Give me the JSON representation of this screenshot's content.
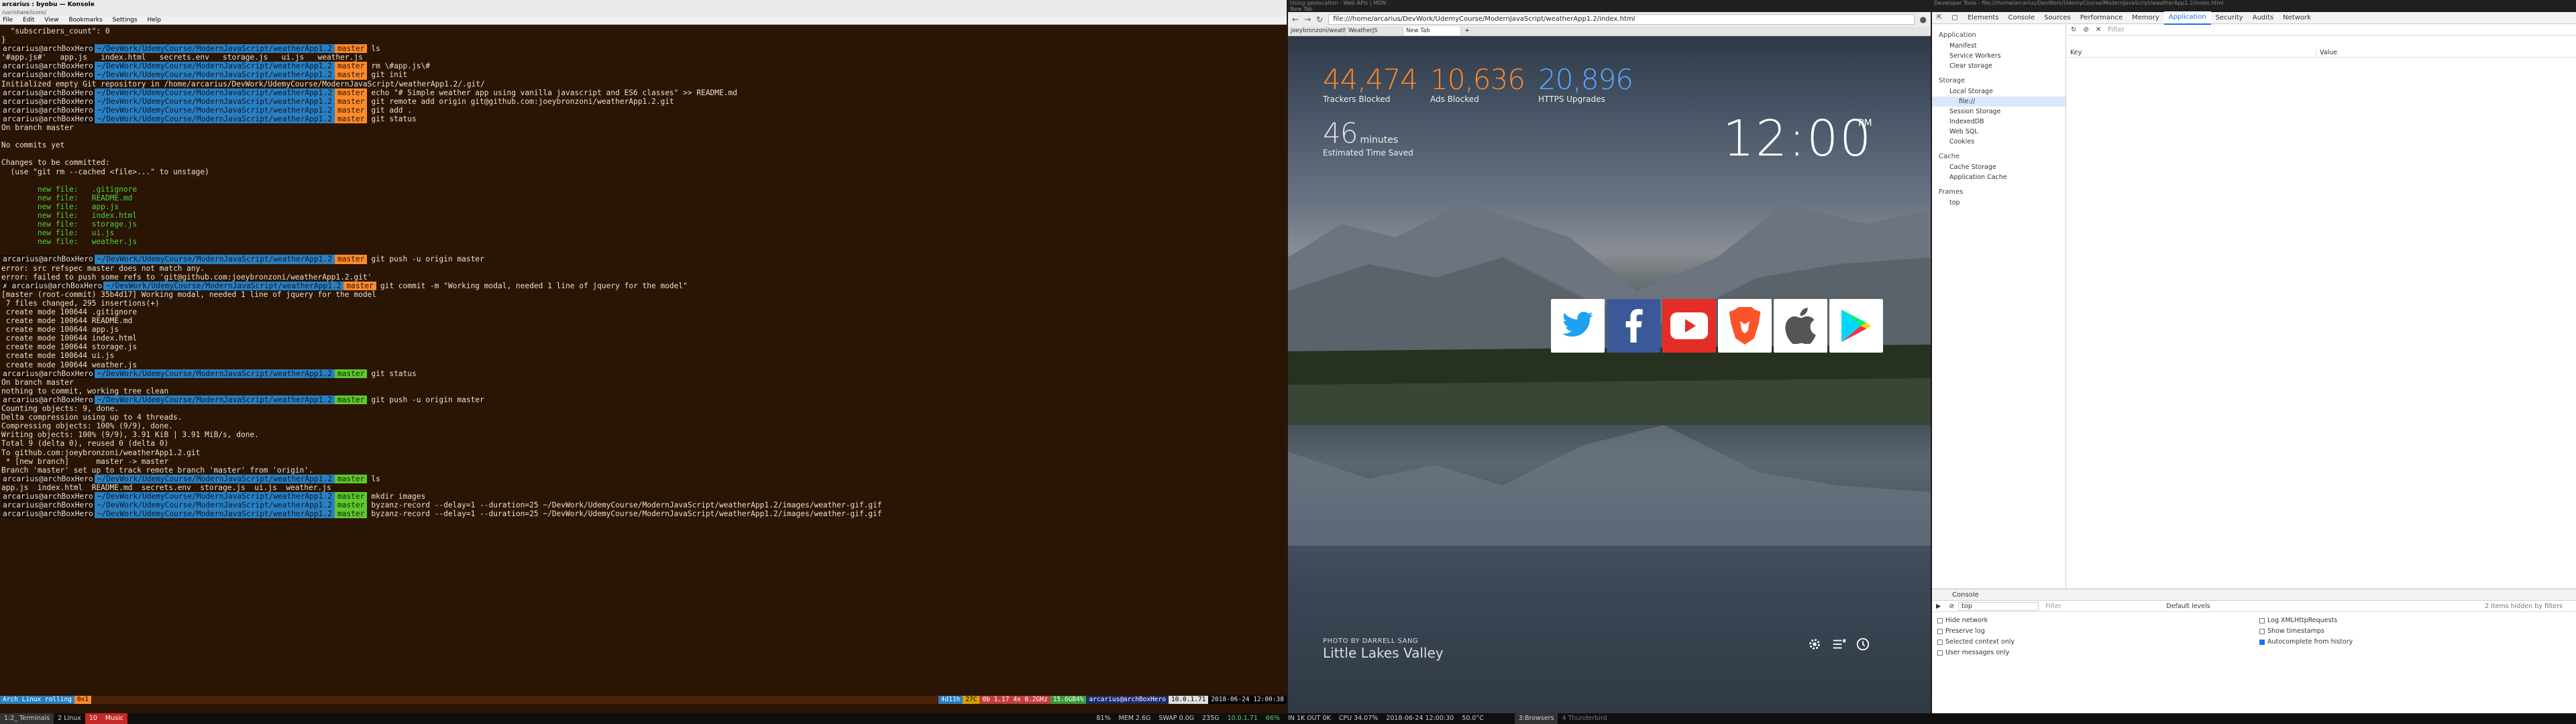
{
  "terminal": {
    "title": "arcarius : byobu — Konsole",
    "path": "/usr/share/icons/",
    "menu": [
      "File",
      "Edit",
      "View",
      "Bookmarks",
      "Settings",
      "Help"
    ],
    "user": "arcarius@archBoxHero",
    "path_prompt": "~/DevWork/UdemyCourse/ModernJavaScript/weatherApp1.2",
    "branch": "master",
    "lines_top": [
      "  \"subscribers_count\": 0",
      "}"
    ],
    "ls1": "'#app.js#'   app.js   index.html   secrets.env   storage.js   ui.js   weather.js",
    "cmd_ls": "ls",
    "cmd_rm": "rm \\#app.js\\#",
    "cmd_init": "git init",
    "init_out": "Initialized empty Git repository in /home/arcarius/DevWork/UdemyCourse/ModernJavaScript/weatherApp1.2/.git/",
    "cmd_echo": "echo \"# Simple weather app using vanilla javascript and ES6 classes\" >> README.md",
    "cmd_remote": "git remote add origin git@github.com:joeybronzoni/weatherApp1.2.git",
    "cmd_add": "git add .",
    "cmd_status": "git status",
    "status_out": [
      "On branch master",
      "",
      "No commits yet",
      "",
      "Changes to be committed:",
      "  (use \"git rm --cached <file>...\" to unstage)",
      ""
    ],
    "new_files": [
      "        new file:   .gitignore",
      "        new file:   README.md",
      "        new file:   app.js",
      "        new file:   index.html",
      "        new file:   storage.js",
      "        new file:   ui.js",
      "        new file:   weather.js"
    ],
    "cmd_push": "git push -u origin master",
    "push_err": [
      "error: src refspec master does not match any.",
      "error: failed to push some refs to 'git@github.com:joeybronzoni/weatherApp1.2.git'"
    ],
    "prompt_err_user": "✗ arcarius@archBoxHero",
    "cmd_commit": "git commit -m \"Working modal, needed 1 line of jquery for the model\"",
    "commit_out": [
      "[master (root-commit) 35b4d17] Working modal, needed 1 line of jquery for the model",
      " 7 files changed, 295 insertions(+)",
      " create mode 100644 .gitignore",
      " create mode 100644 README.md",
      " create mode 100644 app.js",
      " create mode 100644 index.html",
      " create mode 100644 storage.js",
      " create mode 100644 ui.js",
      " create mode 100644 weather.js"
    ],
    "status2_out": [
      "On branch master",
      "nothing to commit, working tree clean"
    ],
    "push_out": [
      "Counting objects: 9, done.",
      "Delta compression using up to 4 threads.",
      "Compressing objects: 100% (9/9), done.",
      "Writing objects: 100% (9/9), 3.91 KiB | 3.91 MiB/s, done.",
      "Total 9 (delta 0), reused 0 (delta 0)",
      "To github.com:joeybronzoni/weatherApp1.2.git",
      " * [new branch]      master -> master",
      "Branch 'master' set up to track remote branch 'master' from 'origin'."
    ],
    "ls2": "app.js  index.html  README.md  secrets.env  storage.js  ui.js  weather.js",
    "cmd_mkdir": "mkdir images",
    "cmd_byzanz1": "byzanz-record --delay=1 --duration=25 ~/DevWork/UdemyCourse/ModernJavaScript/weatherApp1.2/images/weather-gif.gif",
    "cmd_byzanz2": "byzanz-record --delay=1 --duration=25 ~/DevWork/UdemyCourse/ModernJavaScript/weatherApp1.2/images/weather-gif.gif",
    "status_bar": {
      "left": "Arch Linux rolling",
      "load": "0x1",
      "mem": "4d11h",
      "cpu": "27C",
      "sys": "0b  1.17  4x  0.2GHz",
      "ram": "15.6GB4%",
      "host": "arcarius@archBoxHero",
      "ip": "10.0.1.71",
      "datetime": "2018-06-24 12:00:38"
    }
  },
  "browser": {
    "title1": "Using geolocation - Web APIs | MDN",
    "title2": "New Tab",
    "url": "file:///home/arcarius/DevWork/UdemyCourse/ModernJavaScript/weatherApp1.2/index.html",
    "tabs": [
      "joeybronzoni/weatherApp",
      "WeatherJS",
      "New Tab"
    ],
    "stats": [
      {
        "value": "44,474",
        "label": "Trackers Blocked",
        "color": "#ff8a2b"
      },
      {
        "value": "10,636",
        "label": "Ads Blocked",
        "color": "#ff8a2b"
      },
      {
        "value": "20,896",
        "label": "HTTPS Upgrades",
        "color": "#5aa9ff"
      }
    ],
    "time_saved_value": "46",
    "time_saved_unit": "minutes",
    "time_saved_label": "Estimated Time Saved",
    "clock": "12:00",
    "ampm": "PM",
    "photo_by": "PHOTO BY DARRELL SANG",
    "photo_name": "Little Lakes Valley"
  },
  "devtools": {
    "title": "Developer Tools - file:///home/arcarius/DevWork/UdemyCourse/ModernJavaScript/weatherApp1.2/index.html",
    "tabs": [
      "Elements",
      "Console",
      "Sources",
      "Performance",
      "Memory",
      "Application",
      "Security",
      "Audits",
      "Network"
    ],
    "active_tab": "Application",
    "filter_placeholder": "Filter",
    "sections": {
      "application": "Application",
      "app_items": [
        "Manifest",
        "Service Workers",
        "Clear storage"
      ],
      "storage": "Storage",
      "storage_items": [
        "Local Storage",
        "file://",
        "Session Storage",
        "IndexedDB",
        "Web SQL",
        "Cookies"
      ],
      "cache": "Cache",
      "cache_items": [
        "Cache Storage",
        "Application Cache"
      ],
      "frames": "Frames",
      "frames_items": [
        "top"
      ]
    },
    "table": {
      "key": "Key",
      "value": "Value"
    },
    "console": {
      "title": "Console",
      "context": "top",
      "filter": "Filter",
      "levels": "Default levels",
      "hidden": "2 items hidden by filters",
      "left_opts": [
        "Hide network",
        "Preserve log",
        "Selected context only",
        "User messages only"
      ],
      "right_opts": [
        "Log XMLHttpRequests",
        "Show timestamps",
        "Autocomplete from history"
      ]
    }
  },
  "taskbar": {
    "left": [
      "1:2_ Terminals",
      "2 Linux",
      "10",
      "Music"
    ],
    "center": [
      "81%",
      "MEM 2.6G",
      "SWAP 0.0G",
      "235G",
      "10.0.1.71",
      "66%",
      "IN 1K OUT 0K",
      "CPU 34.07%",
      "2018-06-24 12:00:30",
      "50.0°C"
    ],
    "browsers": "3:Browsers",
    "thunderbird": "4 Thunderbird"
  },
  "colors": {
    "twitter": "#1da1f2",
    "facebook": "#3b5998",
    "youtube": "#e52d27",
    "brave": "#fb542b",
    "apple": "#555555",
    "play": "#ffffff"
  }
}
